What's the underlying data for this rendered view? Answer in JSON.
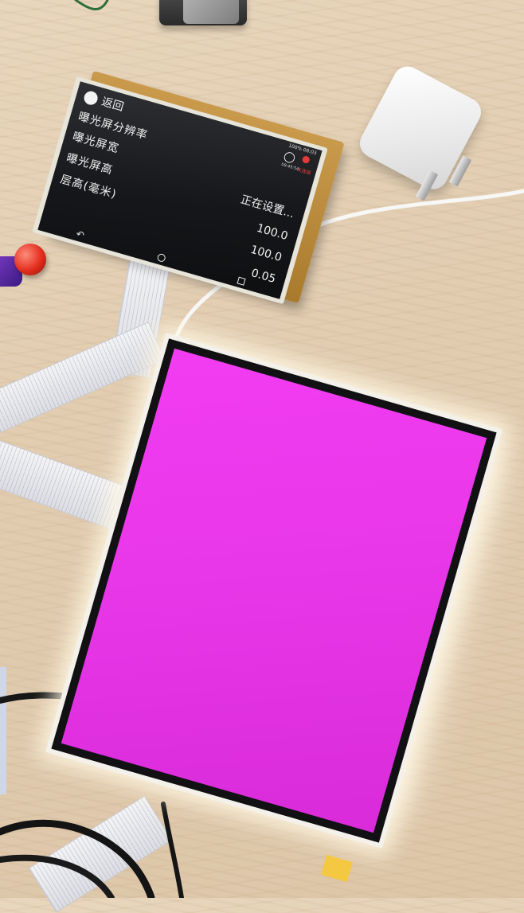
{
  "small_display": {
    "back_label": "返回",
    "status_text": "100% 08:03",
    "status_time": "09:45:54",
    "status_tag": "未连接",
    "settings": [
      {
        "label": "曝光屏分辨率"
      },
      {
        "label": "曝光屏宽"
      },
      {
        "label": "曝光屏高"
      },
      {
        "label": "层高(毫米)"
      }
    ],
    "values": [
      "正在设置...",
      "100.0",
      "100.0",
      "0.05"
    ]
  },
  "large_display": {
    "screen_color": "#e837e8"
  },
  "colors": {
    "desk": "#e2cdb1",
    "pcb": "#b98a3c",
    "screen_dark": "#15171a"
  },
  "icons": [
    "bulb-icon",
    "bug-icon",
    "back-icon",
    "home-icon",
    "recents-icon"
  ]
}
